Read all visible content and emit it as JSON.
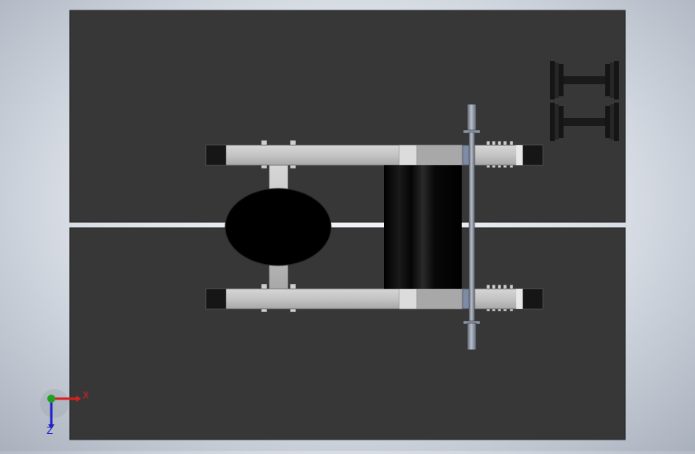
{
  "viewport": {
    "background_gradient": [
      "#f4f6f9",
      "#a9b1bd"
    ],
    "floor_color": "#373737",
    "frame_color": "#c9c9c9",
    "pad_color": "#000000",
    "bar_color": "#8f98a8"
  },
  "triad": {
    "x_label": "X",
    "z_label": "Z",
    "x_color": "#d62020",
    "z_color": "#2020c8",
    "y_color": "#20a020"
  }
}
